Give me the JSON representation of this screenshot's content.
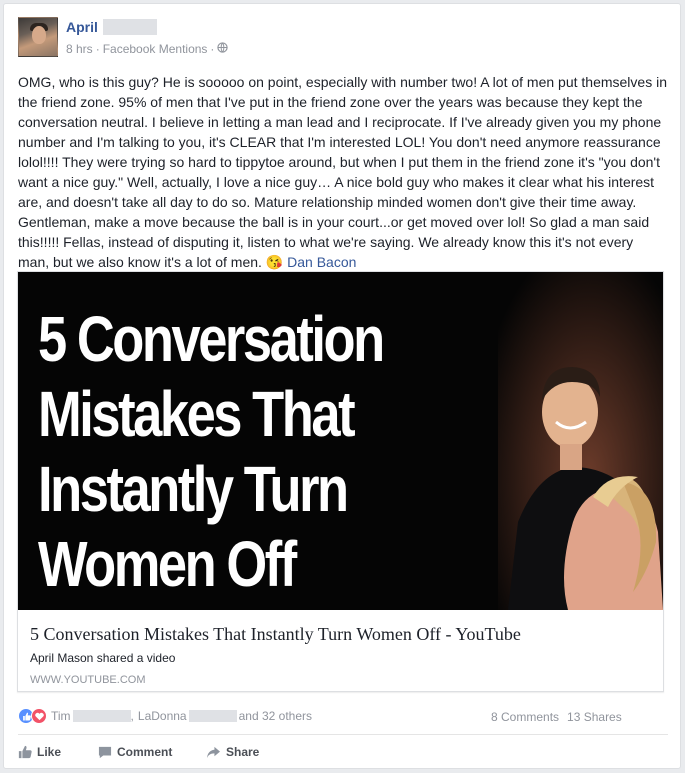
{
  "post": {
    "author_first": "April",
    "time": "8 hrs",
    "separator": "·",
    "app": "Facebook Mentions",
    "separator2": "·",
    "privacy_icon": "globe-icon",
    "text": "OMG, who is this guy? He is sooooo on point, especially with number two! A lot of men put themselves in the friend zone. 95% of men that I've put in the friend zone over the years was because they kept the conversation neutral. I believe in letting a man lead and I reciprocate. If I've already given you my phone number and I'm talking to you, it's CLEAR that I'm interested LOL! You don't need anymore reassurance lolol!!!! They were trying so hard to tippytoe around, but when I put them in the friend zone it's \"you don't want a nice guy.\" Well, actually, I love a nice guy… A nice bold guy who makes it clear what his interest are, and doesn't take all day to do so. Mature relationship minded women don't give their time away. Gentleman, make a move because the ball is in your court...or get moved over lol! So glad a man said this!!!!! Fellas, instead of disputing it, listen to what we're saying. We already know this it's not every man, but we also know it's a lot of men.",
    "emoji": "😘",
    "mention": "Dan Bacon"
  },
  "link": {
    "thumb_lines": [
      "5 Conversation",
      "Mistakes That",
      "Instantly Turn",
      "Women Off"
    ],
    "title": "5 Conversation Mistakes That Instantly Turn Women Off - YouTube",
    "subtitle": "April Mason shared a video",
    "domain": "WWW.YOUTUBE.COM"
  },
  "reactions": {
    "name1": "Tim",
    "comma": ",",
    "name2": "LaDonna",
    "others": "and 32 others",
    "comments": "8 Comments",
    "shares": "13 Shares",
    "icons": [
      "like-icon",
      "love-icon"
    ],
    "like_color": "#5890ff",
    "love_color": "#f25268"
  },
  "actions": {
    "like": "Like",
    "comment": "Comment",
    "share": "Share"
  },
  "colors": {
    "link_blue": "#365899",
    "meta_gray": "#90949c",
    "background": "#e9ebee"
  }
}
